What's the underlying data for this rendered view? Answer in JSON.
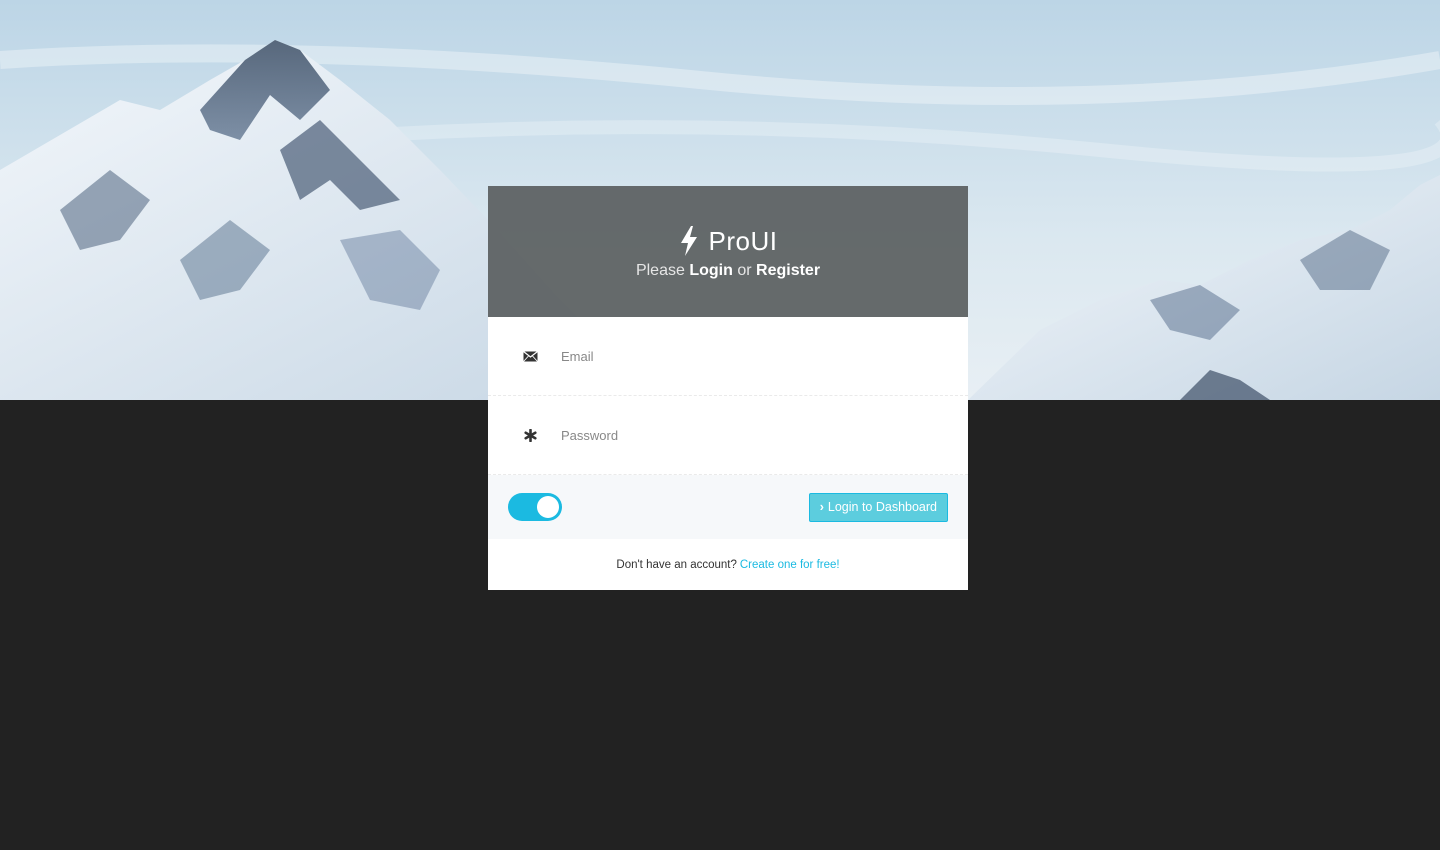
{
  "brand": {
    "name": "ProUI",
    "icon": "bolt-icon"
  },
  "tagline": {
    "prefix": "Please",
    "login": "Login",
    "joiner": "or",
    "register": "Register"
  },
  "form": {
    "email": {
      "placeholder": "Email",
      "value": "",
      "icon": "envelope-icon"
    },
    "password": {
      "placeholder": "Password",
      "value": "",
      "icon": "asterisk-icon"
    },
    "remember_toggle": {
      "state": "on"
    },
    "submit": {
      "icon": "chevron-right-icon",
      "chevron": "›",
      "label": "Login to Dashboard"
    }
  },
  "footer": {
    "question": "Don't have an account?",
    "link": "Create one for free!"
  },
  "colors": {
    "accent": "#1bbae1",
    "button": "#5ccdde",
    "header_bg": "#5a5e60",
    "page_bg": "#222222"
  }
}
